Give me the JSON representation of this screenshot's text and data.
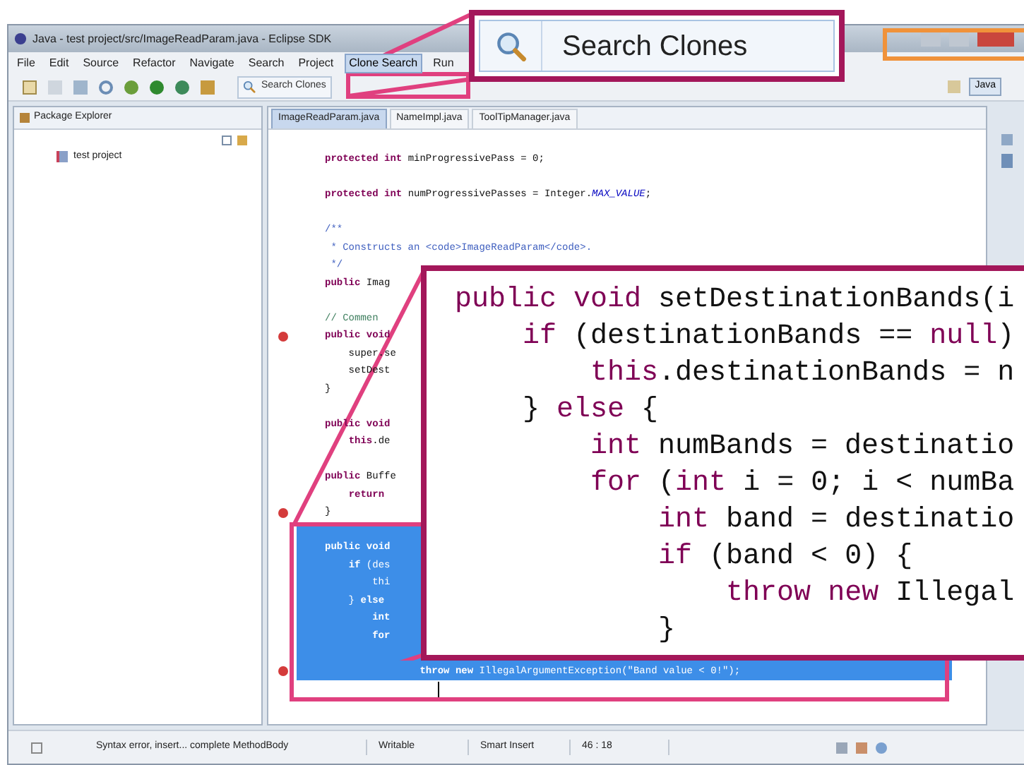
{
  "window": {
    "title": "Java - test project/src/ImageReadParam.java - Eclipse SDK"
  },
  "menu": [
    {
      "label": "File",
      "selected": false
    },
    {
      "label": "Edit",
      "selected": false
    },
    {
      "label": "Source",
      "selected": false
    },
    {
      "label": "Refactor",
      "selected": false
    },
    {
      "label": "Navigate",
      "selected": false
    },
    {
      "label": "Search",
      "selected": false
    },
    {
      "label": "Project",
      "selected": false
    },
    {
      "label": "Clone Search",
      "selected": true
    },
    {
      "label": "Run",
      "selected": false
    }
  ],
  "toolbar": {
    "search_clones": {
      "label": "Search Clones"
    },
    "perspective": {
      "label": "Java",
      "selected": true
    }
  },
  "package_explorer": {
    "title": "Package Explorer",
    "items": [
      {
        "label": "test project"
      }
    ]
  },
  "editor": {
    "tabs": [
      {
        "label": "ImageReadParam.java",
        "selected": true
      },
      {
        "label": "NameImpl.java",
        "selected": false
      },
      {
        "label": "ToolTipManager.java",
        "selected": false
      }
    ],
    "lines": [
      {
        "kind": "code",
        "text": "**protected** **int** minProgressivePass = 0;",
        "blank_before": false,
        "selected": false,
        "error": false
      },
      {
        "kind": "code",
        "text": "**protected** **int** numProgressivePasses = Integer.*MAX_VALUE*;",
        "blank_before": true,
        "selected": false,
        "error": false
      },
      {
        "kind": "javadoc",
        "text": "/**",
        "blank_before": true,
        "selected": false,
        "error": false
      },
      {
        "kind": "javadoc",
        "text": " * Constructs an <code>ImageReadParam</code>.",
        "blank_before": false,
        "selected": false,
        "error": false
      },
      {
        "kind": "javadoc",
        "text": " */",
        "blank_before": false,
        "selected": false,
        "error": false
      },
      {
        "kind": "code",
        "text": "**public** Imag",
        "blank_before": false,
        "selected": false,
        "error": false
      },
      {
        "kind": "comment",
        "text": "// Commen",
        "blank_before": true,
        "selected": false,
        "error": false
      },
      {
        "kind": "code",
        "text": "**public** **void**",
        "blank_before": false,
        "selected": false,
        "error": true
      },
      {
        "kind": "code",
        "text": "    super.se",
        "blank_before": false,
        "selected": false,
        "error": false
      },
      {
        "kind": "code",
        "text": "    setDest",
        "blank_before": false,
        "selected": false,
        "error": false
      },
      {
        "kind": "code",
        "text": "}",
        "blank_before": false,
        "selected": false,
        "error": false
      },
      {
        "kind": "code",
        "text": "**public** **void**",
        "blank_before": true,
        "selected": false,
        "error": false
      },
      {
        "kind": "code",
        "text": "    **this**.de",
        "blank_before": false,
        "selected": false,
        "error": false
      },
      {
        "kind": "code",
        "text": "**public** Buffe",
        "blank_before": true,
        "selected": false,
        "error": false
      },
      {
        "kind": "code",
        "text": "    **return**",
        "blank_before": false,
        "selected": false,
        "error": false
      },
      {
        "kind": "code",
        "text": "}",
        "blank_before": false,
        "selected": false,
        "error": true
      },
      {
        "kind": "code",
        "text": "**public** **void**",
        "blank_before": true,
        "selected": true,
        "error": false
      },
      {
        "kind": "code",
        "text": "    **if** (des",
        "blank_before": false,
        "selected": true,
        "error": false
      },
      {
        "kind": "code",
        "text": "        thi",
        "blank_before": false,
        "selected": true,
        "error": false
      },
      {
        "kind": "code",
        "text": "    } **else**",
        "blank_before": false,
        "selected": true,
        "error": false
      },
      {
        "kind": "code",
        "text": "        **int**",
        "blank_before": false,
        "selected": true,
        "error": false
      },
      {
        "kind": "code",
        "text": "        **for**",
        "blank_before": false,
        "selected": true,
        "error": false
      },
      {
        "kind": "code",
        "text": "                **throw** **new** IllegalArgumentException(\"Band value < 0!\");",
        "blank_before": true,
        "selected": true,
        "error": true
      },
      {
        "kind": "cursor",
        "blank_before": false,
        "selected": false,
        "error": false
      }
    ]
  },
  "status_bar": [
    "Syntax error, insert... complete MethodBody",
    "Writable",
    "Smart Insert",
    "46 : 18"
  ],
  "callouts": {
    "search": {
      "label": "Search Clones"
    },
    "code": {
      "lines": [
        "**public** **void** setDestinationBands(i",
        "    **if** (destinationBands == **null**)",
        "        **this**.destinationBands = n",
        "    } **else** {",
        "        **int** numBands = destinatio",
        "        **for** (**int** i = 0; i < numBa",
        "            **int** band = destinatio",
        "            **if** (band < 0) {",
        "                **throw** **new** Illegal",
        "            }"
      ]
    }
  }
}
